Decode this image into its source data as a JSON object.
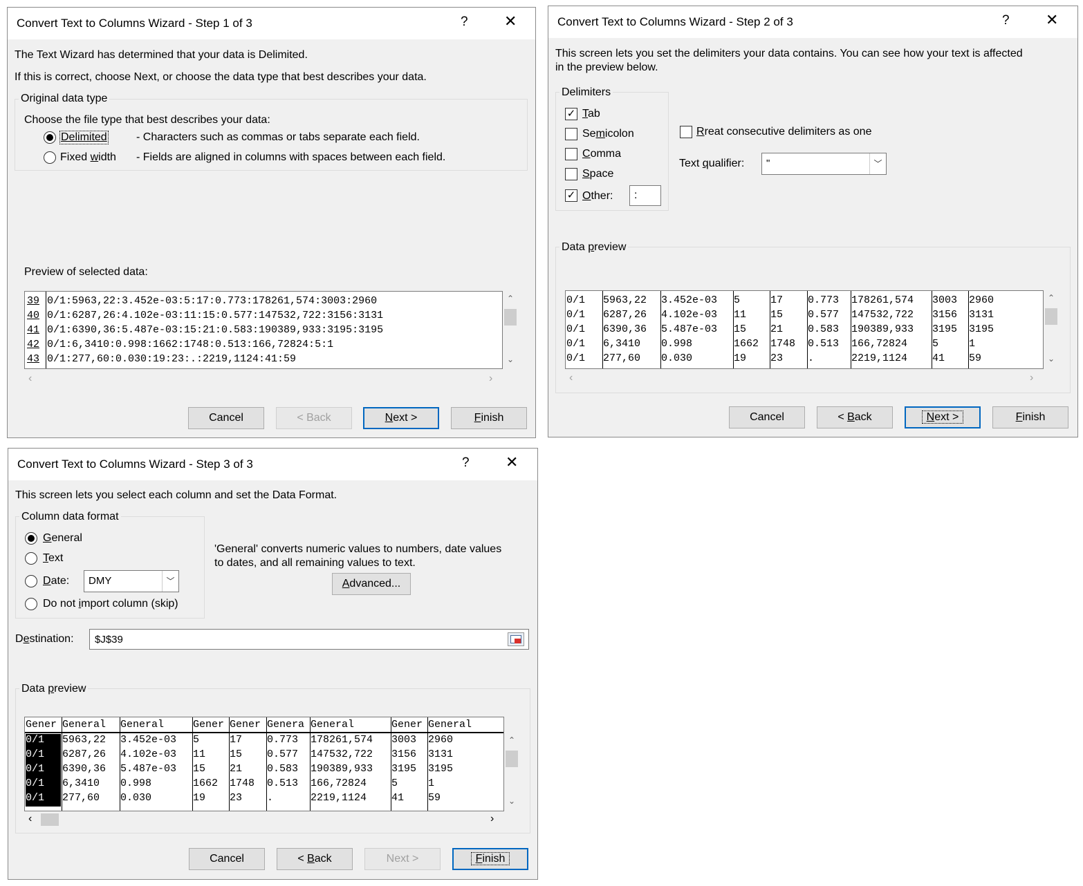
{
  "step1": {
    "title": "Convert Text to Columns Wizard - Step 1 of 3",
    "help": "?",
    "close": "✕",
    "intro1": "The Text Wizard has determined that your data is Delimited.",
    "intro2": "If this is correct, choose Next, or choose the data type that best describes your data.",
    "group_label": "Original data type",
    "choose_label": "Choose the file type that best describes your data:",
    "delimited_label": "Delimited",
    "delimited_desc": "- Characters such as commas or tabs separate each field.",
    "fixed_pre": "Fixed ",
    "fixed_u": "w",
    "fixed_post": "idth",
    "fixed_desc": "- Fields are aligned in columns with spaces between each field.",
    "preview_label": "Preview of selected data:",
    "rows": [
      {
        "num": "39",
        "text": "0/1:5963,22:3.452e-03:5:17:0.773:178261,574:3003:2960"
      },
      {
        "num": "40",
        "text": "0/1:6287,26:4.102e-03:11:15:0.577:147532,722:3156:3131"
      },
      {
        "num": "41",
        "text": "0/1:6390,36:5.487e-03:15:21:0.583:190389,933:3195:3195"
      },
      {
        "num": "42",
        "text": "0/1:6,3410:0.998:1662:1748:0.513:166,72824:5:1"
      },
      {
        "num": "43",
        "text": "0/1:277,60:0.030:19:23:.:2219,1124:41:59"
      }
    ],
    "buttons": {
      "cancel": "Cancel",
      "back": "< Back",
      "next_u": "N",
      "next_rest": "ext >",
      "finish_u": "F",
      "finish_rest": "inish"
    }
  },
  "step2": {
    "title": "Convert Text to Columns Wizard - Step 2 of 3",
    "help": "?",
    "close": "✕",
    "intro": "This screen lets you set the delimiters your data contains.  You can see how your text is affected",
    "intro_2": "in the preview below.",
    "delimiters_label": "Delimiters",
    "tab": {
      "u": "T",
      "rest": "ab"
    },
    "semicolon": {
      "pre": "Se",
      "u": "m",
      "rest": "icolon"
    },
    "comma": {
      "u": "C",
      "rest": "omma"
    },
    "space": {
      "u": "S",
      "rest": "pace"
    },
    "other": {
      "u": "O",
      "rest": "ther:"
    },
    "other_value": ":",
    "check_mark": "✓",
    "consecutive": {
      "u": "R",
      "rest": "reat consecutive delimiters as one"
    },
    "qualifier_pre": "Text ",
    "qualifier_u": "q",
    "qualifier_rest": "ualifier:",
    "qualifier_value": "\"",
    "dropdown_glyph": "﹀",
    "data_preview": {
      "pre": "Data ",
      "u": "p",
      "rest": "review"
    },
    "grid": [
      [
        "0/1",
        "5963,22",
        "3.452e-03",
        "5",
        "17",
        "0.773",
        "178261,574",
        "3003",
        "2960"
      ],
      [
        "0/1",
        "6287,26",
        "4.102e-03",
        "11",
        "15",
        "0.577",
        "147532,722",
        "3156",
        "3131"
      ],
      [
        "0/1",
        "6390,36",
        "5.487e-03",
        "15",
        "21",
        "0.583",
        "190389,933",
        "3195",
        "3195"
      ],
      [
        "0/1",
        "6,3410",
        "0.998",
        "1662",
        "1748",
        "0.513",
        "166,72824",
        "5",
        "1"
      ],
      [
        "0/1",
        "277,60",
        "0.030",
        "19",
        "23",
        ".",
        "2219,1124",
        "41",
        "59"
      ]
    ],
    "buttons": {
      "cancel": "Cancel",
      "back_pre": "< ",
      "back_u": "B",
      "back_rest": "ack",
      "next_u": "N",
      "next_rest": "ext >",
      "finish_u": "F",
      "finish_rest": "inish"
    }
  },
  "step3": {
    "title": "Convert Text to Columns Wizard - Step 3 of 3",
    "help": "?",
    "close": "✕",
    "intro": "This screen lets you select each column and set the Data Format.",
    "format_label": "Column data format",
    "general": {
      "u": "G",
      "rest": "eneral"
    },
    "text": {
      "u": "T",
      "rest": "ext"
    },
    "date": {
      "u": "D",
      "rest": "ate:"
    },
    "date_value": "DMY",
    "skip": {
      "pre": "Do not ",
      "u": "i",
      "rest": "mport column (skip)"
    },
    "general_desc1": "'General' converts numeric values to numbers, date values",
    "general_desc2": "to dates, and all remaining values to text.",
    "advanced": {
      "u": "A",
      "rest": "dvanced..."
    },
    "destination": {
      "pre": "D",
      "u": "e",
      "rest": "stination:"
    },
    "destination_value": "$J$39",
    "data_preview": {
      "pre": "Data ",
      "u": "p",
      "rest": "review"
    },
    "headers": [
      "Gener",
      "General",
      "General",
      "Gener",
      "Gener",
      "Genera",
      "General",
      "Gener",
      "General"
    ],
    "grid": [
      [
        "0/1",
        "5963,22",
        "3.452e-03",
        "5",
        "17",
        "0.773",
        "178261,574",
        "3003",
        "2960"
      ],
      [
        "0/1",
        "6287,26",
        "4.102e-03",
        "11",
        "15",
        "0.577",
        "147532,722",
        "3156",
        "3131"
      ],
      [
        "0/1",
        "6390,36",
        "5.487e-03",
        "15",
        "21",
        "0.583",
        "190389,933",
        "3195",
        "3195"
      ],
      [
        "0/1",
        "6,3410",
        "0.998",
        "1662",
        "1748",
        "0.513",
        "166,72824",
        "5",
        "1"
      ],
      [
        "0/1",
        "277,60",
        "0.030",
        "19",
        "23",
        ".",
        "2219,1124",
        "41",
        "59"
      ]
    ],
    "buttons": {
      "cancel": "Cancel",
      "back_pre": "< ",
      "back_u": "B",
      "back_rest": "ack",
      "next": "Next >",
      "finish_u": "F",
      "finish_rest": "inish"
    }
  },
  "colors": {
    "accent": "#0067c0",
    "dialog_bg": "#f0f0f0",
    "selected_column": "#000000"
  }
}
